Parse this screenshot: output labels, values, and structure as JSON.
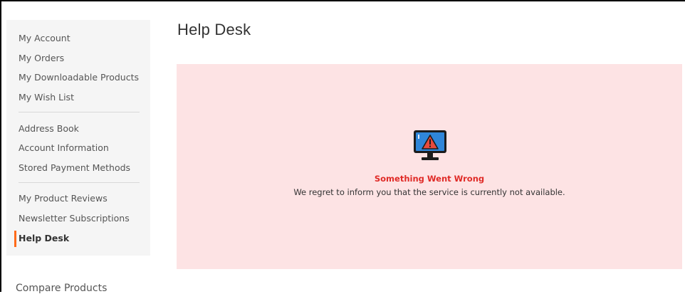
{
  "sidebar": {
    "group1": [
      "My Account",
      "My Orders",
      "My Downloadable Products",
      "My Wish List"
    ],
    "group2": [
      "Address Book",
      "Account Information",
      "Stored Payment Methods"
    ],
    "group3": [
      "My Product Reviews",
      "Newsletter Subscriptions",
      "Help Desk"
    ],
    "active": "Help Desk"
  },
  "compare": {
    "title": "Compare Products"
  },
  "main": {
    "title": "Help Desk",
    "error": {
      "icon": "monitor-warning-icon",
      "title": "Something Went Wrong",
      "message": "We regret to inform you that the service is currently not available."
    }
  },
  "colors": {
    "accent": "#ff6b1a",
    "error_text": "#e02b27",
    "error_bg": "#fde3e4",
    "sidebar_bg": "#f5f5f5"
  }
}
